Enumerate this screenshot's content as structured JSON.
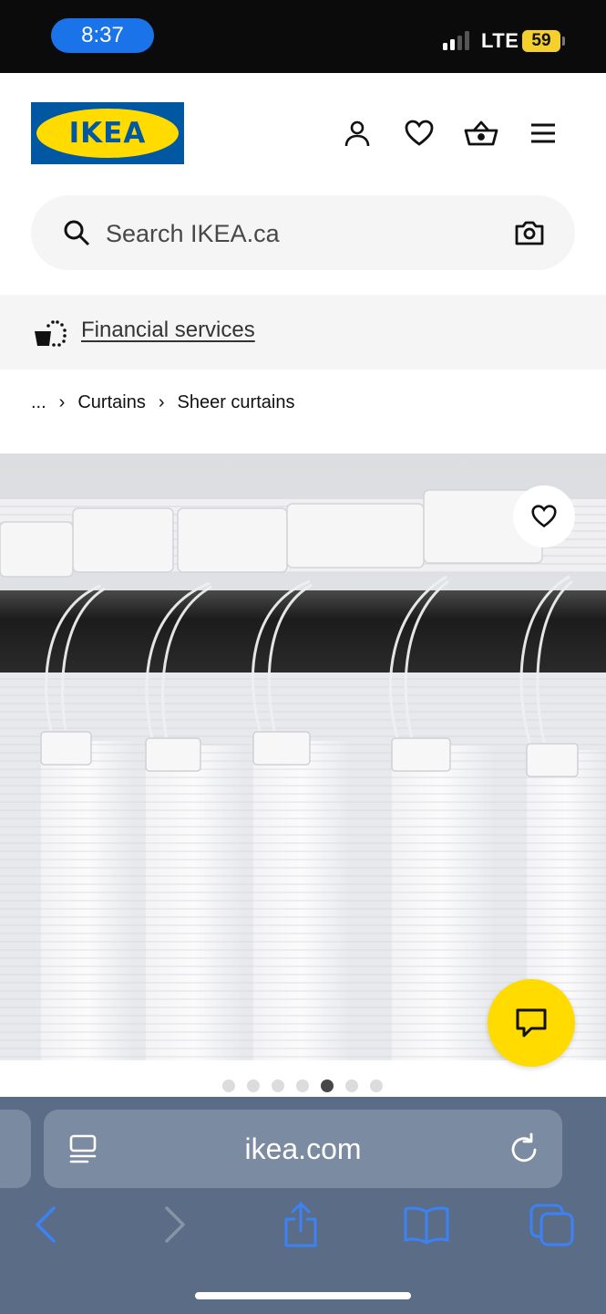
{
  "status_bar": {
    "time": "8:37",
    "network": "LTE",
    "battery": "59"
  },
  "header": {
    "logo_text": "IKEA",
    "logo_reg": "®",
    "icons": [
      "user-icon",
      "heart-icon",
      "basket-icon",
      "menu-icon"
    ]
  },
  "search": {
    "placeholder": "Search IKEA.ca",
    "icon": "search-icon",
    "camera_icon": "camera-icon"
  },
  "banner": {
    "link_label": "Financial services",
    "icon": "financial-services-icon"
  },
  "breadcrumb": {
    "ellipsis": "...",
    "separator": "›",
    "items": [
      "Curtains",
      "Sheer curtains"
    ]
  },
  "product": {
    "favorite_icon": "heart-icon",
    "chat_icon": "chat-icon",
    "carousel": {
      "count": 7,
      "active_index": 4
    }
  },
  "safari": {
    "url": "ikea.com",
    "toolbar": [
      "back-icon",
      "forward-icon",
      "share-icon",
      "bookmarks-icon",
      "tabs-icon"
    ]
  },
  "colors": {
    "ikea_blue": "#0058a3",
    "ikea_yellow": "#ffdb00",
    "safari_accent": "#3b82f6"
  }
}
